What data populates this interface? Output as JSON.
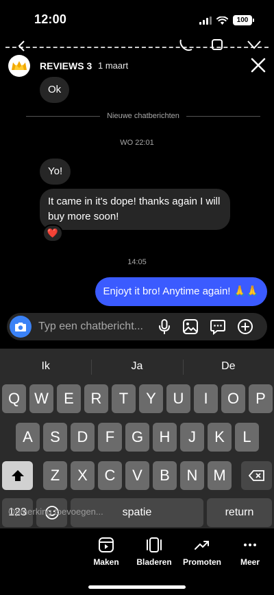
{
  "status": {
    "time": "12:00",
    "battery": "100",
    "signal_icon": "signal-icon",
    "wifi_icon": "wifi-icon"
  },
  "header": {
    "name": "REVIEWS 3",
    "date": "1 maart",
    "close_icon": "close-icon"
  },
  "messages": {
    "first": "Ok",
    "divider": "Nieuwe chatberichten",
    "timestamp1": "WO 22:01",
    "yo": "Yo!",
    "long": "It came in it's dope! thanks again I will buy more soon!",
    "reaction": "❤️",
    "timestamp2": "14:05",
    "outgoing": "Enjoyt it bro! Anytime again! 🙏🙏"
  },
  "composer": {
    "placeholder": "Typ een chatbericht...",
    "icons": [
      "camera-icon",
      "microphone-icon",
      "image-icon",
      "sticker-icon",
      "plus-icon"
    ],
    "accent": "#3b82f6"
  },
  "keyboard": {
    "suggestions": [
      "Ik",
      "Ja",
      "De"
    ],
    "row1": [
      "Q",
      "W",
      "E",
      "R",
      "T",
      "Y",
      "U",
      "I",
      "O",
      "P"
    ],
    "row2": [
      "A",
      "S",
      "D",
      "F",
      "G",
      "H",
      "J",
      "K",
      "L"
    ],
    "row3": [
      "Z",
      "X",
      "C",
      "V",
      "B",
      "N",
      "M"
    ],
    "numbers_key": "123",
    "space": "spatie",
    "return": "return"
  },
  "overlay": {
    "caption_placeholder": "Opmerking toevoegen...",
    "actions": [
      "Maken",
      "Bladeren",
      "Promoten",
      "Meer"
    ]
  },
  "colors": {
    "outgoing_bubble": "#3b5bff",
    "incoming_bubble": "#262626"
  }
}
